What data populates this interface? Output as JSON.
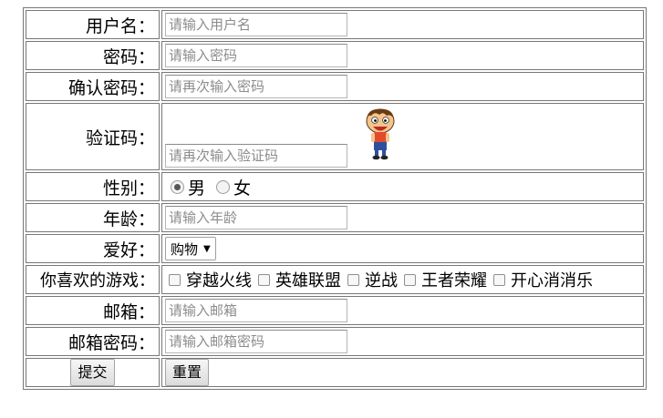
{
  "form": {
    "username": {
      "label": "用户名：",
      "placeholder": "请输入用户名"
    },
    "password": {
      "label": "密码：",
      "placeholder": "请输入密码"
    },
    "confirm_password": {
      "label": "确认密码：",
      "placeholder": "请再次输入密码"
    },
    "captcha": {
      "label": "验证码：",
      "placeholder": "请再次输入验证码",
      "image_icon": "cartoon-boy-icon"
    },
    "gender": {
      "label": "性别：",
      "options": [
        "男",
        "女"
      ],
      "selected": "男"
    },
    "age": {
      "label": "年龄：",
      "placeholder": "请输入年龄"
    },
    "hobby": {
      "label": "爱好：",
      "selected": "购物"
    },
    "games": {
      "label": "你喜欢的游戏：",
      "options": [
        "穿越火线",
        "英雄联盟",
        "逆战",
        "王者荣耀",
        "开心消消乐"
      ]
    },
    "email": {
      "label": "邮箱：",
      "placeholder": "请输入邮箱"
    },
    "email_password": {
      "label": "邮箱密码：",
      "placeholder": "请输入邮箱密码"
    },
    "submit_label": "提交",
    "reset_label": "重置"
  }
}
